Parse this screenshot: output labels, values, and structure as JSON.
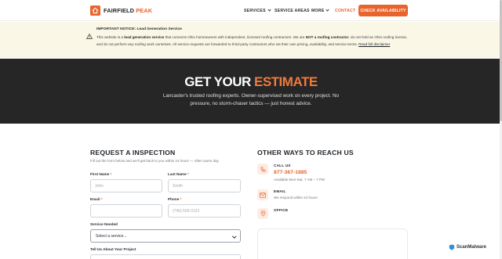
{
  "header": {
    "brand_part1": "FAIRFIELD ",
    "brand_part2": "PEAK",
    "nav": {
      "services": "SERVICES",
      "service_areas": "SERVICE AREAS",
      "more": "MORE",
      "contact": "CONTACT"
    },
    "cta": "CHECK AVAILABILITY"
  },
  "notice": {
    "title": "IMPORTANT NOTICE: Lead Generation Service",
    "p1": "This website is a ",
    "b1": "lead generation service",
    "p2": " that connects Ohio homeowners with independent, licensed roofing contractors. We are ",
    "b2": "NOT a roofing contractor",
    "p3": ", do not hold an Ohio roofing license, and do not perform any roofing work ourselves. All service requests are forwarded to third-party contractors who set their own pricing, availability, and service terms. ",
    "link": "Read full disclaimer"
  },
  "hero": {
    "title_part1": "GET YOUR ",
    "title_part2": "ESTIMATE",
    "subtitle": "Lancaster's trusted roofing experts. Owner-supervised work on every project. No pressure, no storm-chaser tactics — just honest advice."
  },
  "form": {
    "title": "REQUEST A INSPECTION",
    "subtitle": "Fill out the form below and we'll get back to you within 24 hours — often same day.",
    "first_name": {
      "label": "First Name",
      "placeholder": "John"
    },
    "last_name": {
      "label": "Last Name",
      "placeholder": "Smith"
    },
    "email": {
      "label": "Email",
      "placeholder": ""
    },
    "phone": {
      "label": "Phone",
      "placeholder": "(740) 555-0123"
    },
    "service": {
      "label": "Service Needed",
      "value": "Select a service..."
    },
    "project": {
      "label": "Tell Us About Your Project"
    },
    "required_mark": "*"
  },
  "other_ways": {
    "title": "OTHER WAYS TO REACH US",
    "call": {
      "label": "CALL US",
      "value": "877-367-1885",
      "hint": "Available Mon-Sat, 7 AM – 7 PM"
    },
    "email": {
      "label": "EMAIL",
      "hint": "We respond within 24 hours"
    },
    "office": {
      "label": "OFFICE"
    }
  },
  "watermark": "ScanMalware",
  "colors": {
    "accent": "#e8642c",
    "hero_bg": "#262626",
    "notice_bg": "#fbf7e7"
  }
}
